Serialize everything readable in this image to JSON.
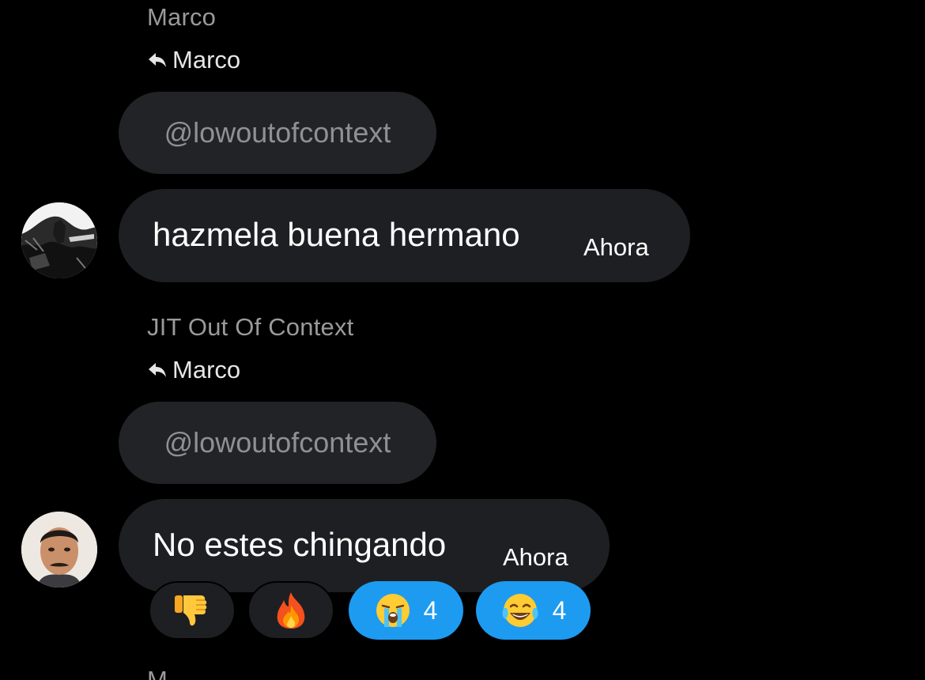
{
  "messages": [
    {
      "sender": "Marco",
      "reply_to": "Marco",
      "quoted": "@lowoutofcontext",
      "text": "hazmela buena hermano",
      "time": "Ahora",
      "avatar": "landscape-avatar"
    },
    {
      "sender": "JIT Out Of Context",
      "reply_to": "Marco",
      "quoted": "@lowoutofcontext",
      "text": "No estes chingando",
      "time": "Ahora",
      "avatar": "man-portrait-avatar"
    }
  ],
  "reactions": [
    {
      "emoji": "thumbs-down",
      "count": "",
      "active": false
    },
    {
      "emoji": "fire",
      "count": "",
      "active": false
    },
    {
      "emoji": "loudly-crying-face",
      "count": "4",
      "active": true
    },
    {
      "emoji": "face-with-tears-of-joy",
      "count": "4",
      "active": true
    }
  ],
  "next_sender_partial": "M",
  "colors": {
    "background": "#000000",
    "bubble": "#1e1f22",
    "quote_bubble": "#222326",
    "active_reaction": "#1d9bf0",
    "muted_text": "#9a9a9a"
  }
}
